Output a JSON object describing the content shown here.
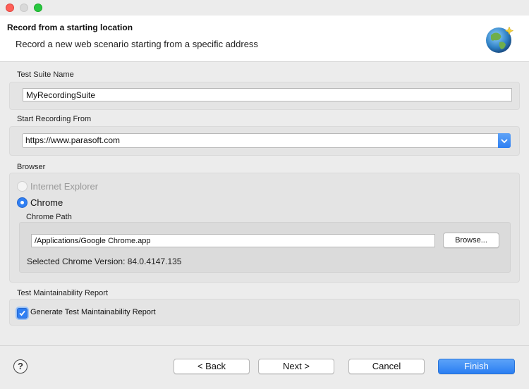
{
  "header": {
    "title": "Record from a starting location",
    "subtitle": "Record a new web scenario starting from a specific address",
    "icon": "globe-icon"
  },
  "test_suite": {
    "label": "Test Suite Name",
    "value": "MyRecordingSuite"
  },
  "start_recording": {
    "label": "Start Recording From",
    "value": "https://www.parasoft.com"
  },
  "browser": {
    "label": "Browser",
    "options": [
      {
        "label": "Internet Explorer",
        "selected": false,
        "enabled": false
      },
      {
        "label": "Chrome",
        "selected": true,
        "enabled": true
      }
    ],
    "chrome_path_label": "Chrome Path",
    "chrome_path_value": "/Applications/Google Chrome.app",
    "browse_label": "Browse...",
    "version_text": "Selected Chrome Version: 84.0.4147.135"
  },
  "maintainability": {
    "label": "Test Maintainability Report",
    "checkbox_label": "Generate Test Maintainability Report",
    "checked": true
  },
  "footer": {
    "help_glyph": "?",
    "back_label": "< Back",
    "next_label": "Next >",
    "cancel_label": "Cancel",
    "finish_label": "Finish"
  },
  "colors": {
    "accent": "#2f7ff3",
    "window_bg": "#ececec"
  }
}
